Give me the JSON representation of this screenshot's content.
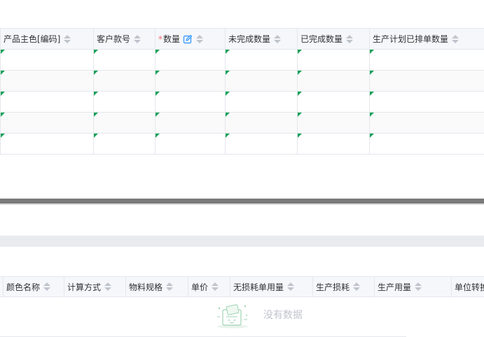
{
  "top_table": {
    "columns": [
      {
        "label": "产品主色[编码]",
        "required": false,
        "editable": false
      },
      {
        "label": "客户款号",
        "required": false,
        "editable": false
      },
      {
        "label": "数量",
        "required": true,
        "editable": true
      },
      {
        "label": "未完成数量",
        "required": false,
        "editable": false
      },
      {
        "label": "已完成数量",
        "required": false,
        "editable": false
      },
      {
        "label": "生产计划已排单数量",
        "required": false,
        "editable": false
      }
    ],
    "required_mark": "*",
    "rows": [
      [
        "",
        "",
        "",
        "",
        "",
        ""
      ],
      [
        "",
        "",
        "",
        "",
        "",
        ""
      ],
      [
        "",
        "",
        "",
        "",
        "",
        ""
      ],
      [
        "",
        "",
        "",
        "",
        "",
        ""
      ],
      [
        "",
        "",
        "",
        "",
        "",
        ""
      ]
    ]
  },
  "bottom_table": {
    "columns": [
      "颜色名称",
      "计算方式",
      "物料规格",
      "单价",
      "无损耗单用量",
      "生产损耗",
      "生产用量",
      "单位转换"
    ],
    "empty_text": "没有数据"
  },
  "colors": {
    "header_bg": "#f5f7fa",
    "border": "#e4e7ed",
    "dirty_marker": "#18a058",
    "required": "#f56c6c",
    "edit_icon": "#409eff",
    "sort_icon": "#c0c4cc"
  },
  "icons": {
    "sort": "sort-caret-icon",
    "edit": "edit-icon",
    "empty": "empty-data-icon"
  }
}
